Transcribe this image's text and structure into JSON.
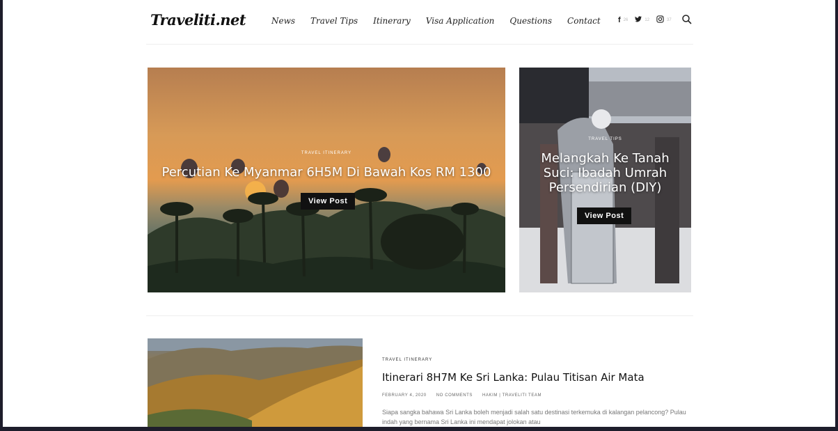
{
  "site": {
    "logo": "Traveliti.net"
  },
  "nav": [
    "News",
    "Travel Tips",
    "Itinerary",
    "Visa Application",
    "Questions",
    "Contact"
  ],
  "social": [
    {
      "icon": "facebook-icon",
      "glyph": "f",
      "count": "26"
    },
    {
      "icon": "twitter-icon",
      "glyph": "🐦",
      "count": "12"
    },
    {
      "icon": "instagram-icon",
      "glyph": "◎",
      "count": "37"
    }
  ],
  "hero": [
    {
      "category": "TRAVEL ITINERARY",
      "title": "Percutian Ke Myanmar 6H5M Di Bawah Kos RM 1300",
      "button": "View Post"
    },
    {
      "category": "TRAVEL TIPS",
      "title": "Melangkah Ke Tanah Suci: Ibadah Umrah Persendirian (DIY)",
      "button": "View Post"
    }
  ],
  "post": {
    "category": "TRAVEL ITINERARY",
    "title": "Itinerari 8H7M Ke Sri Lanka: Pulau Titisan Air Mata",
    "date": "FEBRUARY 4, 2020",
    "comments": "NO COMMENTS",
    "author": "HAKIM | TRAVELITI TEAM",
    "excerpt": "Siapa sangka bahawa Sri Lanka boleh menjadi salah satu destinasi terkemuka di kalangan pelancong? Pulau indah yang bernama Sri Lanka ini mendapat jolokan atau"
  }
}
